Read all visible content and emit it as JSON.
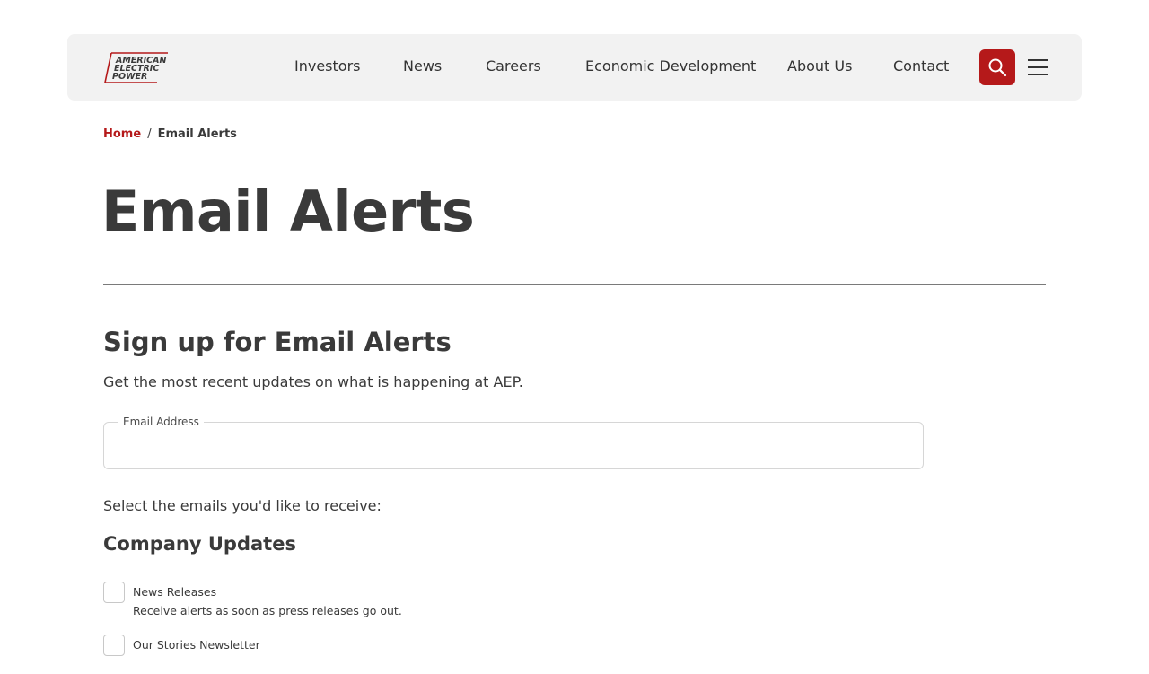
{
  "brand": {
    "logo_text": [
      "AMERICAN",
      "ELECTRIC",
      "POWER"
    ],
    "accent_color": "#b5191a"
  },
  "nav": {
    "items": [
      "Investors",
      "News",
      "Careers",
      "Economic Development",
      "About Us",
      "Contact"
    ],
    "search_icon": "search-icon",
    "menu_icon": "hamburger-menu-icon"
  },
  "breadcrumb": {
    "home": "Home",
    "separator": "/",
    "current": "Email Alerts"
  },
  "page": {
    "title": "Email Alerts"
  },
  "signup": {
    "title": "Sign up for Email Alerts",
    "description": "Get the most recent updates on what is happening at AEP.",
    "email_label": "Email Address",
    "email_value": "",
    "select_prompt": "Select the emails you'd like to receive:"
  },
  "groups": [
    {
      "title": "Company Updates",
      "options": [
        {
          "label": "News Releases",
          "description": "Receive alerts as soon as press releases go out.",
          "checked": false
        },
        {
          "label": "Our Stories Newsletter",
          "description": "",
          "checked": false
        }
      ]
    }
  ]
}
